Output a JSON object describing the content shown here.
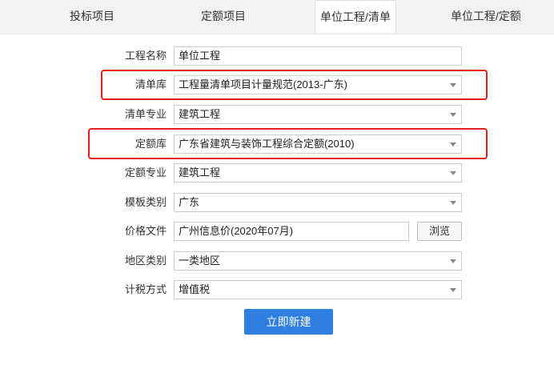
{
  "tabs": [
    {
      "label": "投标项目"
    },
    {
      "label": "定额项目"
    },
    {
      "label": "单位工程/清单"
    },
    {
      "label": "单位工程/定额"
    }
  ],
  "form": {
    "project_name": {
      "label": "工程名称",
      "value": "单位工程"
    },
    "bill_library": {
      "label": "清单库",
      "value": "工程量清单项目计量规范(2013-广东)"
    },
    "bill_specialty": {
      "label": "清单专业",
      "value": "建筑工程"
    },
    "quota_library": {
      "label": "定额库",
      "value": "广东省建筑与装饰工程综合定额(2010)"
    },
    "quota_specialty": {
      "label": "定额专业",
      "value": "建筑工程"
    },
    "template_category": {
      "label": "模板类别",
      "value": "广东"
    },
    "price_file": {
      "label": "价格文件",
      "value": "广州信息价(2020年07月)",
      "browse_label": "浏览"
    },
    "region_category": {
      "label": "地区类别",
      "value": "一类地区"
    },
    "tax_method": {
      "label": "计税方式",
      "value": "增值税"
    }
  },
  "actions": {
    "create_label": "立即新建"
  },
  "colors": {
    "highlight": "#e02020",
    "primary": "#2f7fe0"
  }
}
